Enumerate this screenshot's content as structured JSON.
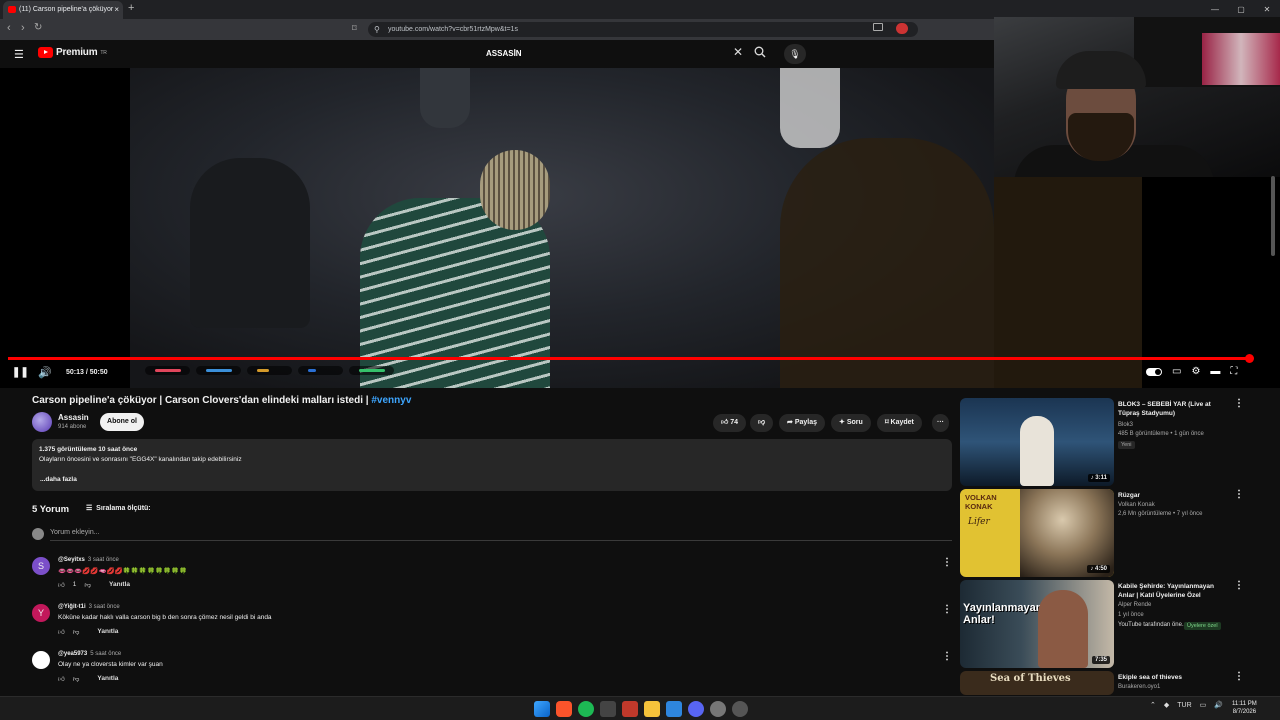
{
  "browser": {
    "tab_title": "(11) Carson pipeline'a çöküyor",
    "tab_close": "×",
    "new_tab": "+",
    "url": "youtube.com/watch?v=cbr51rtzMpw&t=1s",
    "window_controls": [
      "—",
      "▢",
      "✕"
    ]
  },
  "youtube": {
    "logo_text": "Premium",
    "logo_sup": "TR",
    "search_value": "ASSASİN"
  },
  "player": {
    "time": "50:13 / 50:50",
    "progress_fraction": 0.988
  },
  "video": {
    "title_text": "Carson pipeline'a çöküyor | Carson Clovers'dan elindeki malları istedi | ",
    "title_hashtag": "#vennyv",
    "channel_name": "Assasin",
    "subscribers": "914 abone",
    "subscribe_label": "Abone ol",
    "like_count": "74",
    "share_label": "Paylaş",
    "ask_label": "Soru",
    "save_label": "Kaydet",
    "more_label": "···"
  },
  "description": {
    "stats": "1.375 görüntüleme  10 saat önce",
    "text": "Olayların öncesini ve sonrasını \"EGG4X\" kanalından takip edebilirsiniz",
    "more": "...daha fazla"
  },
  "comments": {
    "count_label": "5 Yorum",
    "sort_label": "Sıralama ölçütü:",
    "add_placeholder": "Yorum ekleyin...",
    "reply_label": "Yanıtla",
    "items": [
      {
        "initial": "S",
        "author": "@Seyitxs",
        "time": "3 saat önce",
        "text": "👄👄👄💋💋🫦💋💋🍀🍀🍀🍀🍀🍀🍀🍀",
        "likes": "1",
        "avatar_color": "#7b4fc9"
      },
      {
        "initial": "Y",
        "author": "@Yiğit-t1i",
        "time": "3 saat önce",
        "text": "Köküne kadar haklı valla carson big b den sonra çömez nesil geldi bi anda",
        "likes": "",
        "avatar_color": "#c2185b"
      },
      {
        "initial": "",
        "author": "@yea5973",
        "time": "5 saat önce",
        "text": "Olay ne  ya cloversta kimler var şuan",
        "likes": "",
        "avatar_color": "#ffffff"
      }
    ]
  },
  "recommendations": [
    {
      "title": "BLOK3 – SEBEBİ YAR (Live at Tüpraş Stadyumu)",
      "channel": "Blok3",
      "meta": "485 B görüntüleme • 1 gün önce",
      "tag": "Yeni",
      "duration": "♪ 3:11"
    },
    {
      "title": "Rüzgar",
      "channel": "Volkan Konak",
      "meta": "2,6 Mn görüntüleme • 7 yıl önce",
      "tag": "",
      "duration": "♪ 4:50",
      "thumb_text_1": "VOLKAN KONAK",
      "thumb_text_2": "Lifer"
    },
    {
      "title": "Kabile Şehirde: Yayınlanmayan Anlar | Katıl Üyelerine Özel",
      "channel": "Alper Rende",
      "meta": "1 yıl önce",
      "meta2": "YouTube tarafından öne...",
      "tag": "Üyelere özel",
      "duration": "7:35",
      "thumb_text_1": "Yayınlanmayan Anlar!"
    },
    {
      "title": "Ekiple sea of thieves",
      "channel": "Burakeren.oyo1",
      "meta": "",
      "tag": "",
      "duration": "",
      "thumb_text_1": "Sea of Thieves"
    }
  ],
  "taskbar": {
    "lang": "TUR",
    "time": "11:11 PM",
    "date": "8/7/2026"
  },
  "colors": {
    "accent_red": "#ff0000",
    "background": "#0f0f0f",
    "surface": "#272727",
    "link_blue": "#3ea6ff"
  }
}
